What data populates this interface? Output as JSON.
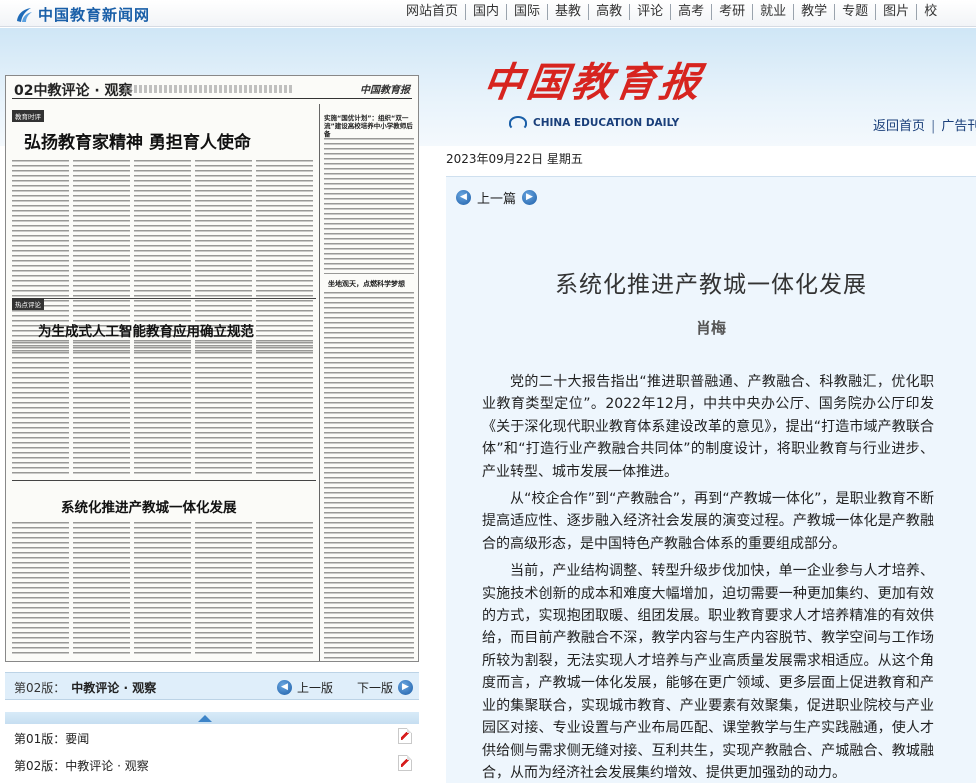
{
  "site": {
    "name": "中国教育新闻网",
    "nav": [
      "网站首页",
      "国内",
      "国际",
      "基教",
      "高教",
      "评论",
      "高考",
      "考研",
      "就业",
      "教学",
      "专题",
      "图片",
      "校"
    ]
  },
  "masthead": {
    "title_cn": "中国教育报",
    "title_en": "CHINA EDUCATION DAILY",
    "links": [
      "返回首页",
      "广告刊"
    ]
  },
  "page_image": {
    "page_no": "02中教评论 · 观察",
    "paper_logo": "中国教育报",
    "headlines": [
      "弘扬教育家精神  勇担育人使命",
      "为生成式人工智能教育应用确立规范",
      "系统化推进产教城一体化发展"
    ],
    "side_title": "实施“国优计划”：组织“双一流”建设高校培养中小学教师后备",
    "side_title2": "坐地观天，点燃科学梦想",
    "section_tags": [
      "教育时评",
      "热点评论",
      "热点评论"
    ]
  },
  "version_bar": {
    "current_label": "第02版：",
    "current_name": "中教评论 · 观察",
    "prev_label": "上一版",
    "next_label": "下一版"
  },
  "editions": [
    {
      "label": "第01版：要闻"
    },
    {
      "label": "第02版：中教评论 · 观察"
    }
  ],
  "article": {
    "date": "2023年09月22日  星期五",
    "prev_label": "上一篇",
    "title": "系统化推进产教城一体化发展",
    "author": "肖梅",
    "paragraphs": [
      "党的二十大报告指出“推进职普融通、产教融合、科教融汇，优化职业教育类型定位”。2022年12月，中共中央办公厅、国务院办公厅印发《关于深化现代职业教育体系建设改革的意见》，提出“打造市域产教联合体”和“打造行业产教融合共同体”的制度设计，将职业教育与行业进步、产业转型、城市发展一体推进。",
      "从“校企合作”到“产教融合”，再到“产教城一体化”，是职业教育不断提高适应性、逐步融入经济社会发展的演变过程。产教城一体化是产教融合的高级形态，是中国特色产教融合体系的重要组成部分。",
      "当前，产业结构调整、转型升级步伐加快，单一企业参与人才培养、实施技术创新的成本和难度大幅增加，迫切需要一种更加集约、更加有效的方式，实现抱团取暖、组团发展。职业教育要求人才培养精准的有效供给，而目前产教融合不深，教学内容与生产内容脱节、教学空间与工作场所较为割裂，无法实现人才培养与产业高质量发展需求相适应。从这个角度而言，产教城一体化发展，能够在更广领域、更多层面上促进教育和产业的集聚联合，实现城市教育、产业要素有效聚集，促进职业院校与产业园区对接、专业设置与产业布局匹配、课堂教学与生产实践融通，使人才供给侧与需求侧无缝对接、互利共生，实现产教融合、产城融合、教城融合，从而为经济社会发展集约增效、提供更加强劲的动力。"
    ]
  }
}
